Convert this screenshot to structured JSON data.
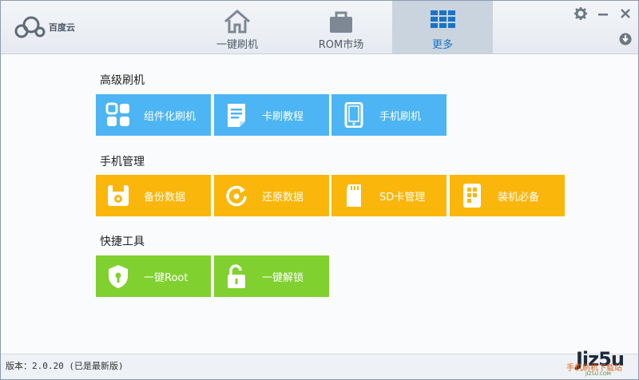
{
  "app": {
    "logo_text": "百度云"
  },
  "tabs": [
    {
      "label": "一键刷机",
      "icon": "home-icon",
      "active": false
    },
    {
      "label": "ROM市场",
      "icon": "bag-icon",
      "active": false
    },
    {
      "label": "更多",
      "icon": "grid-icon",
      "active": true
    }
  ],
  "window_controls": {
    "settings": "gear-icon",
    "minimize": "minimize-icon",
    "close": "close-icon",
    "download": "download-icon"
  },
  "sections": [
    {
      "title": "高级刷机",
      "tiles": [
        {
          "label": "组件化刷机",
          "icon": "component-grid-icon",
          "color": "#4db5f3"
        },
        {
          "label": "卡刷教程",
          "icon": "document-icon",
          "color": "#4db5f3"
        },
        {
          "label": "手机刷机",
          "icon": "tablet-icon",
          "color": "#4db5f3"
        }
      ]
    },
    {
      "title": "手机管理",
      "tiles": [
        {
          "label": "备份数据",
          "icon": "floppy-disk-icon",
          "color": "#fbb60b"
        },
        {
          "label": "还原数据",
          "icon": "restore-icon",
          "color": "#fbb60b"
        },
        {
          "label": "SD卡管理",
          "icon": "sd-card-icon",
          "color": "#fbb60b"
        },
        {
          "label": "装机必备",
          "icon": "phone-apps-icon",
          "color": "#fbb60b"
        }
      ]
    },
    {
      "title": "快捷工具",
      "tiles": [
        {
          "label": "一键Root",
          "icon": "shield-lock-icon",
          "color": "#80d02f"
        },
        {
          "label": "一键解锁",
          "icon": "unlock-icon",
          "color": "#80d02f"
        }
      ]
    }
  ],
  "footer": {
    "version": "版本：2.0.20 (已是最新版)",
    "watermark_main": "Jiz5u",
    "watermark_sub": "手机刷机下载站",
    "watermark_url": "JIZ5U.COM"
  },
  "colors": {
    "blue": "#4db5f3",
    "orange": "#fbb60b",
    "green": "#80d02f",
    "active_tab": "#1a73c9"
  }
}
